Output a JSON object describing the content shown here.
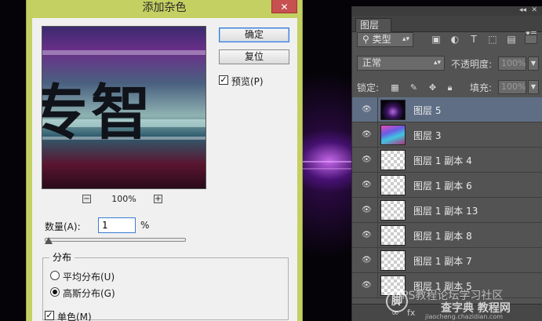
{
  "dialog": {
    "title": "添加杂色",
    "close_label": "✕",
    "ok_label": "确定",
    "reset_label": "复位",
    "preview_label": "预览(P)",
    "preview_checked": true,
    "preview_glyphs": "专智",
    "zoom_out_label": "−",
    "zoom_in_label": "+",
    "zoom_level": "100%",
    "amount_label": "数量(A):",
    "amount_value": "1",
    "amount_unit": "%",
    "distribution_title": "分布",
    "uniform_label": "平均分布(U)",
    "gaussian_label": "高斯分布(G)",
    "distribution_selected": "gaussian",
    "monochrome_label": "单色(M)",
    "monochrome_checked": true
  },
  "panel": {
    "collapse_label": "◂◂",
    "close_label": "✕",
    "tab_label": "图层",
    "menu_label": "▾≡",
    "filter_kind": "类型",
    "blend_mode": "正常",
    "opacity_label": "不透明度:",
    "opacity_value": "100%",
    "lock_label": "锁定:",
    "fill_label": "填充:",
    "fill_value": "100%",
    "layers": [
      {
        "name": "图层 5",
        "thumb": "dark",
        "selected": true
      },
      {
        "name": "图层 3",
        "thumb": "colorful",
        "selected": false
      },
      {
        "name": "图层 1 副本 4",
        "thumb": "transparent",
        "selected": false
      },
      {
        "name": "图层 1 副本 6",
        "thumb": "transparent",
        "selected": false
      },
      {
        "name": "图层 1 副本 13",
        "thumb": "transparent",
        "selected": false
      },
      {
        "name": "图层 1 副本 8",
        "thumb": "transparent",
        "selected": false
      },
      {
        "name": "图层 1 副本 7",
        "thumb": "transparent",
        "selected": false
      },
      {
        "name": "图层 1 副本 5",
        "thumb": "transparent",
        "selected": false
      }
    ],
    "footer_link": "∞",
    "footer_fx": "fx"
  },
  "watermark": {
    "logo": "脚",
    "line1": "PS教程论坛学习社区",
    "line2": "查字典 教程网",
    "line3": "jiaocheng.chazidian.com"
  },
  "colors": {
    "dialog_frame": "#c4d061",
    "panel_bg": "#535353",
    "selected_layer": "#5f6e85",
    "accent_focus": "#3b7bd4"
  }
}
